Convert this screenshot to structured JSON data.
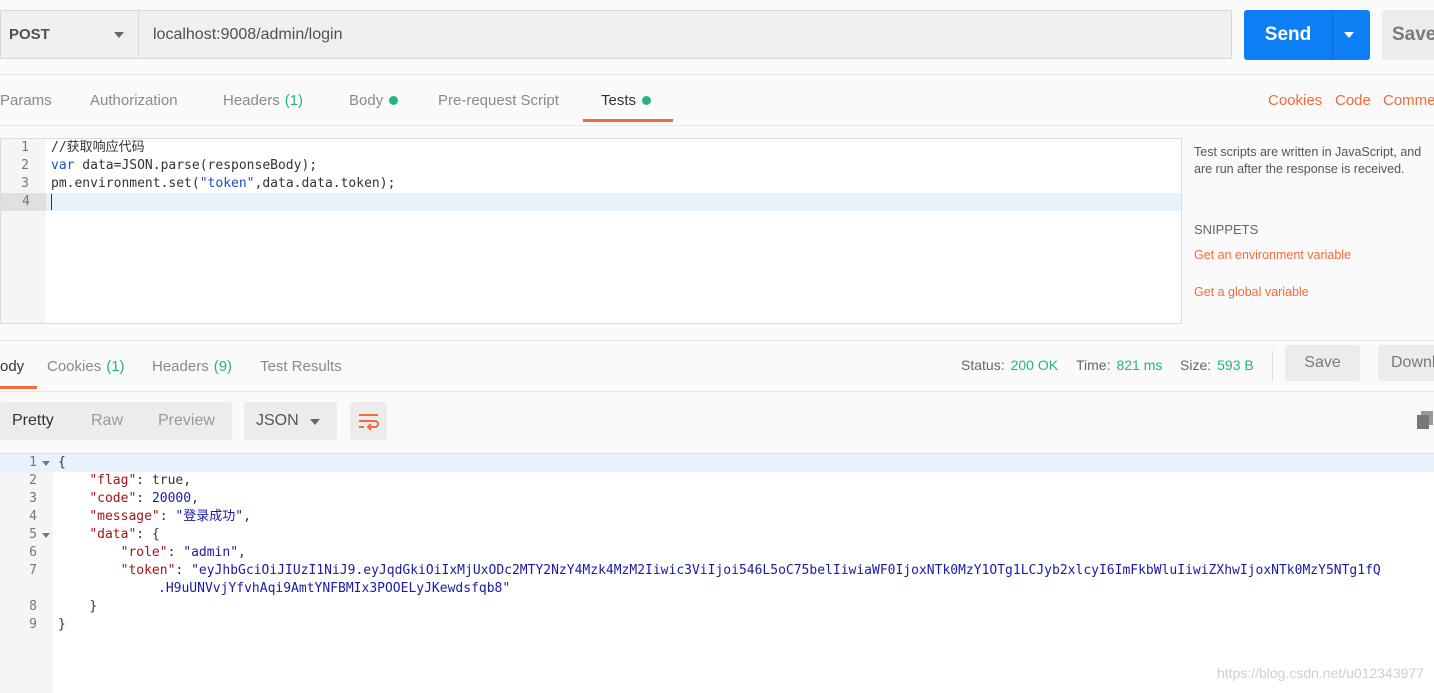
{
  "request": {
    "method": "POST",
    "url": "localhost:9008/admin/login",
    "send_label": "Send",
    "save_label": "Save"
  },
  "request_tabs": {
    "params": "Params",
    "authorization": "Authorization",
    "headers": "Headers",
    "headers_count": "(1)",
    "body": "Body",
    "pre_request": "Pre-request Script",
    "tests": "Tests",
    "active": "Tests"
  },
  "right_links": {
    "cookies": "Cookies",
    "code": "Code",
    "comments": "Comme"
  },
  "editor": {
    "line_numbers": [
      "1",
      "2",
      "3",
      "4"
    ],
    "line1": "//获取响应代码",
    "line2_kw": "var",
    "line2_rest": " data=JSON.parse(responseBody);",
    "line3_a": "pm.environment.set(",
    "line3_str": "\"token\"",
    "line3_b": ",data.data.token);"
  },
  "side_panel": {
    "description": "Test scripts are written in JavaScript, and are run after the response is received.",
    "snippets_title": "SNIPPETS",
    "snippet_1": "Get an environment variable",
    "snippet_2": "Get a global variable"
  },
  "response_tabs": {
    "body": "ody",
    "cookies": "Cookies",
    "cookies_count": "(1)",
    "headers": "Headers",
    "headers_count": "(9)",
    "test_results": "Test Results"
  },
  "response_status": {
    "status_label": "Status:",
    "status_value": "200 OK",
    "time_label": "Time:",
    "time_value": "821 ms",
    "size_label": "Size:",
    "size_value": "593 B",
    "save_label": "Save",
    "download_label": "Downl"
  },
  "view_modes": {
    "pretty": "Pretty",
    "raw": "Raw",
    "preview": "Preview",
    "format": "JSON"
  },
  "response_body": {
    "line_numbers": [
      "1",
      "2",
      "3",
      "4",
      "5",
      "6",
      "7",
      "",
      "8",
      "9"
    ],
    "open_brace": "{",
    "flag_key": "\"flag\"",
    "flag_val": "true",
    "code_key": "\"code\"",
    "code_val": "20000",
    "message_key": "\"message\"",
    "message_val": "\"登录成功\"",
    "data_key": "\"data\"",
    "role_key": "\"role\"",
    "role_val": "\"admin\"",
    "token_key": "\"token\"",
    "token_val_1": "\"eyJhbGciOiJIUzI1NiJ9.eyJqdGkiOiIxMjUxODc2MTY2NzY4Mzk4MzM2Iiwic3ViIjoi546L5oC75belIiwiaWF0IjoxNTk0MzY1OTg1LCJyb2xlcyI6ImFkbWluIiwiZXhwIjoxNTk0MzY5NTg1fQ",
    "token_val_2": ".H9uUNVvjYfvhAqi9AmtYNFBMIx3POOELyJKewdsfqb8\"",
    "close_inner": "}",
    "close_outer": "}"
  },
  "watermark": "https://blog.csdn.net/u012343977"
}
